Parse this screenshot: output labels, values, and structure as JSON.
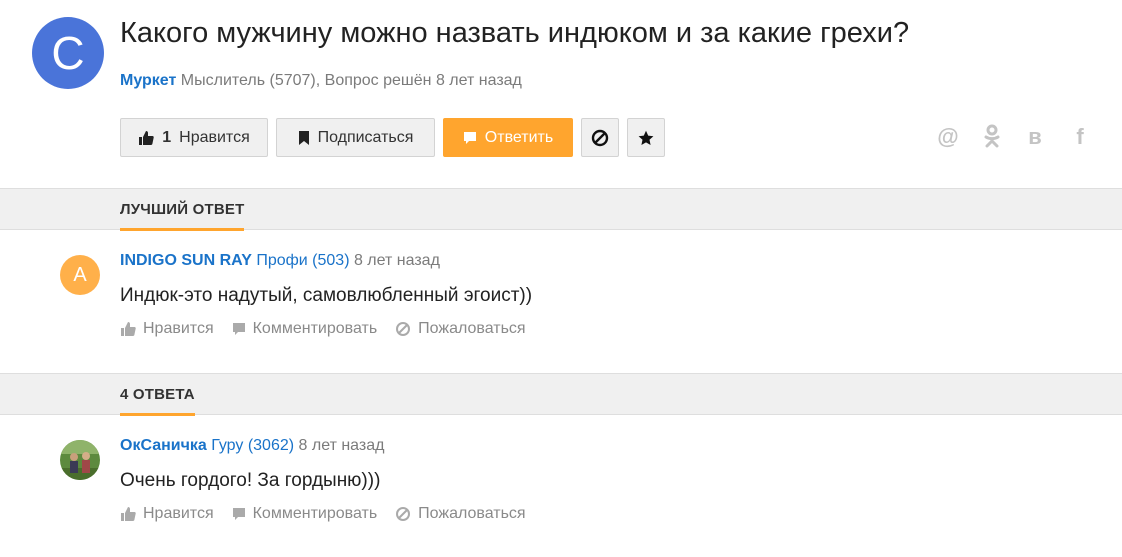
{
  "question": {
    "avatar_letter": "C",
    "title": "Какого мужчину можно назвать индюком и за какие грехи?",
    "author": "Муркет",
    "meta_rest": " Мыслитель (5707), Вопрос решён 8 лет назад",
    "buttons": {
      "like_count": "1",
      "like_label": "Нравится",
      "subscribe_label": "Подписаться",
      "answer_label": "Ответить"
    },
    "share_icons": [
      "@",
      "ok-icon",
      "в",
      "f"
    ]
  },
  "best_answer_section": {
    "label": "ЛУЧШИЙ ОТВЕТ"
  },
  "answers_section": {
    "label": "4 ОТВЕТА"
  },
  "best_answer": {
    "avatar_letter": "А",
    "author": "INDIGO SUN RAY",
    "rank": " Профи (503)",
    "time": " 8 лет назад",
    "text": "Индюк-это надутый, самовлюбленный эгоист))"
  },
  "answers": [
    {
      "author": "ОкСаничка",
      "rank": " Гуру (3062)",
      "time": " 8 лет назад",
      "text": "Очень гордого! За гордыню)))"
    }
  ],
  "actions": {
    "like": "Нравится",
    "comment": "Комментировать",
    "report": "Пожаловаться"
  },
  "colors": {
    "accent": "#ffa52e",
    "link": "#1a73c9",
    "question_avatar": "#4a74d9"
  }
}
